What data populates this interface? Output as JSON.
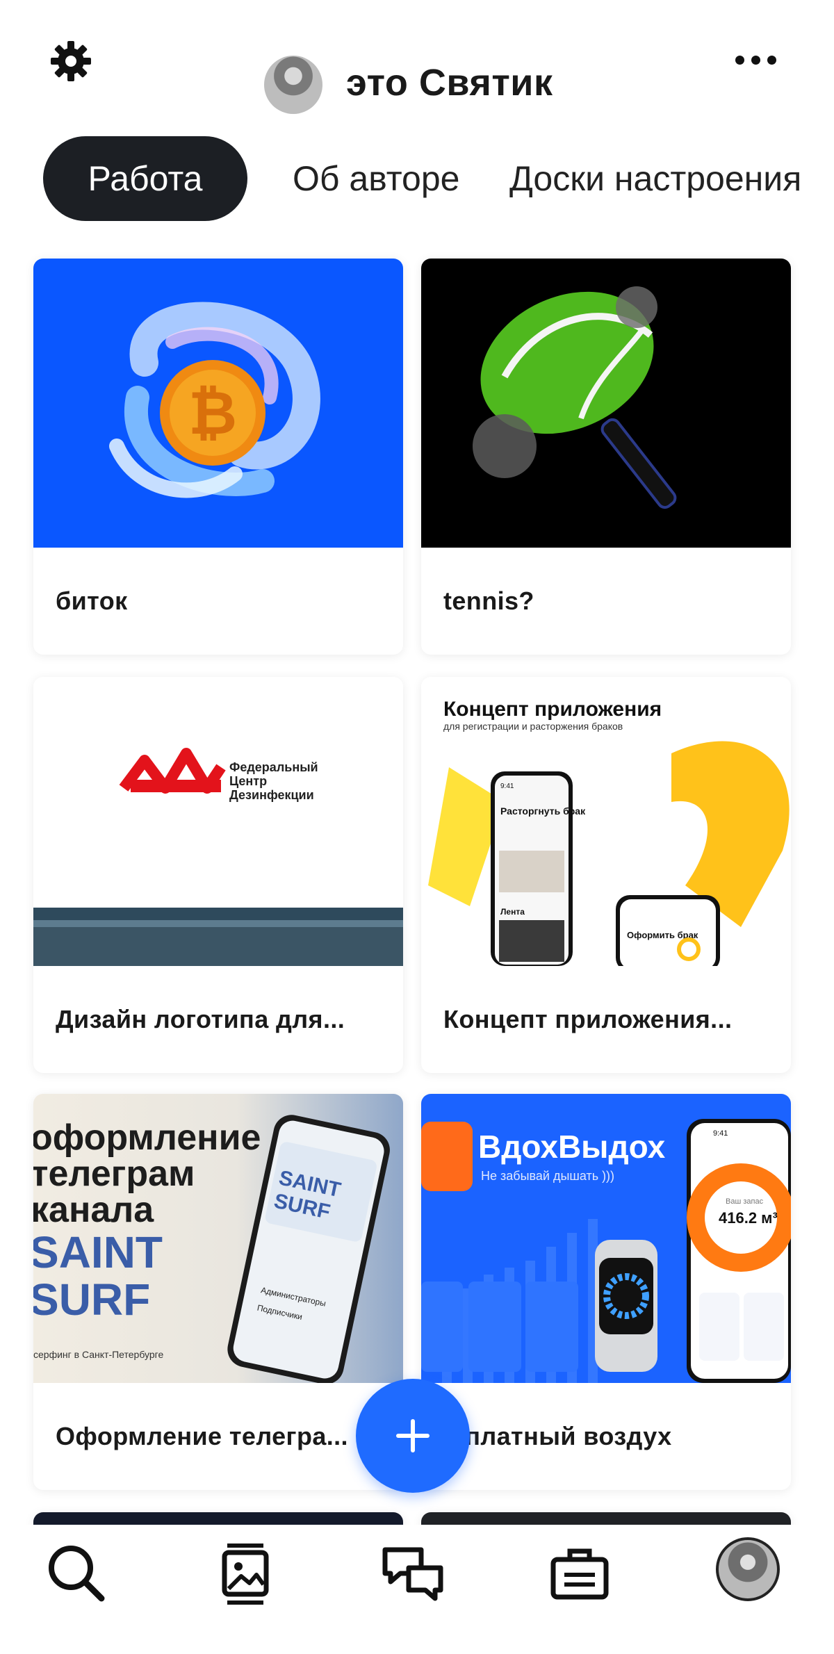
{
  "header": {
    "title": "это Святик",
    "settings_icon": "gear-icon",
    "more_icon": "more-dots-icon"
  },
  "tabs": [
    {
      "label": "Работа",
      "active": true
    },
    {
      "label": "Об авторе",
      "active": false
    },
    {
      "label": "Доски настроения",
      "active": false
    }
  ],
  "cards": [
    {
      "caption": "биток"
    },
    {
      "caption": "tennis?"
    },
    {
      "caption": "Дизайн логотипа для...",
      "image_text": [
        "Федеральный",
        "Центр",
        "Дезинфекции"
      ]
    },
    {
      "caption": "Концепт приложения...",
      "image_text": [
        "Концепт приложения",
        "для регистрации и расторжения браков",
        "Расторгнуть брак",
        "Оформить брак",
        "Лента",
        "9:41"
      ]
    },
    {
      "caption": "Оформление телегра...",
      "image_text": [
        "оформление",
        "телеграм",
        "канала",
        "SAINT",
        "SURF",
        "серфинг в Санкт-Петербурге",
        "Администраторы",
        "Подписчики"
      ]
    },
    {
      "caption": "...платный воздух",
      "image_text": [
        "ВдохВыдох",
        "Не забывай дышать )))",
        "Ваш запас",
        "416.2 м³",
        "9:41"
      ]
    }
  ],
  "fab": {
    "icon": "plus-icon"
  },
  "bottom_nav": [
    {
      "icon": "search-icon"
    },
    {
      "icon": "gallery-icon"
    },
    {
      "icon": "chat-icon"
    },
    {
      "icon": "briefcase-icon"
    },
    {
      "icon": "profile-avatar"
    }
  ],
  "colors": {
    "accent": "#1f6bff",
    "tab_active_bg": "#1c1f24",
    "card_blue": "#0a57ff"
  }
}
